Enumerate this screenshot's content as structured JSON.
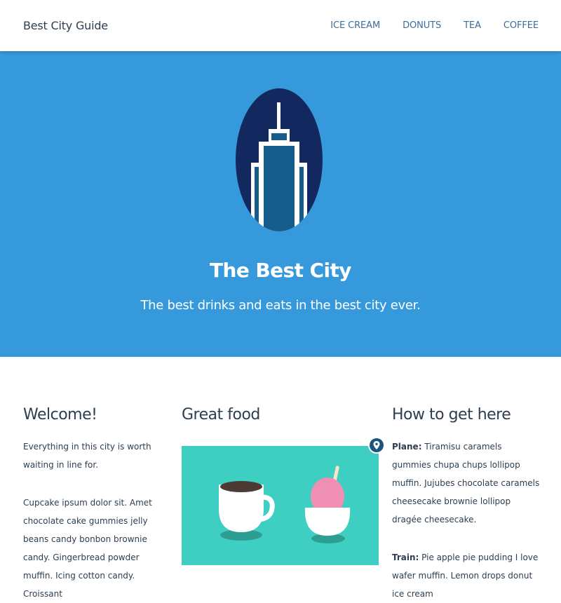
{
  "navbar": {
    "brand": "Best City Guide",
    "links": [
      "ICE CREAM",
      "DONUTS",
      "TEA",
      "COFFEE"
    ]
  },
  "hero": {
    "title": "The Best City",
    "subtitle": "The best drinks and eats in the best city ever.",
    "logo_icon": "skyscraper-icon"
  },
  "welcome": {
    "heading": "Welcome!",
    "intro": "Everything in this city is worth waiting in line for.",
    "body": "Cupcake ipsum dolor sit. Amet chocolate cake gummies jelly beans candy bonbon brownie candy. Gingerbread powder muffin. Icing cotton candy. Croissant"
  },
  "food": {
    "heading": "Great food",
    "image_icons": [
      "coffee-cup-icon",
      "shaved-ice-icon"
    ],
    "pin_icon": "map-pin-icon"
  },
  "travel": {
    "heading": "How to get here",
    "plane_label": "Plane:",
    "plane_text": " Tiramisu caramels gummies chupa chups lollipop muffin. Jujubes chocolate caramels cheesecake brownie lollipop dragée cheesecake.",
    "train_label": "Train:",
    "train_text": " Pie apple pie pudding I love wafer muffin. Lemon drops donut ice cream"
  },
  "colors": {
    "hero_bg": "#3699dc",
    "logo_circle": "#13285f",
    "building": "#175d8c",
    "image_bg": "#3fcfc2",
    "text": "#2d3e50",
    "nav_link": "#3c6d9b",
    "pin": "#1b557d"
  }
}
